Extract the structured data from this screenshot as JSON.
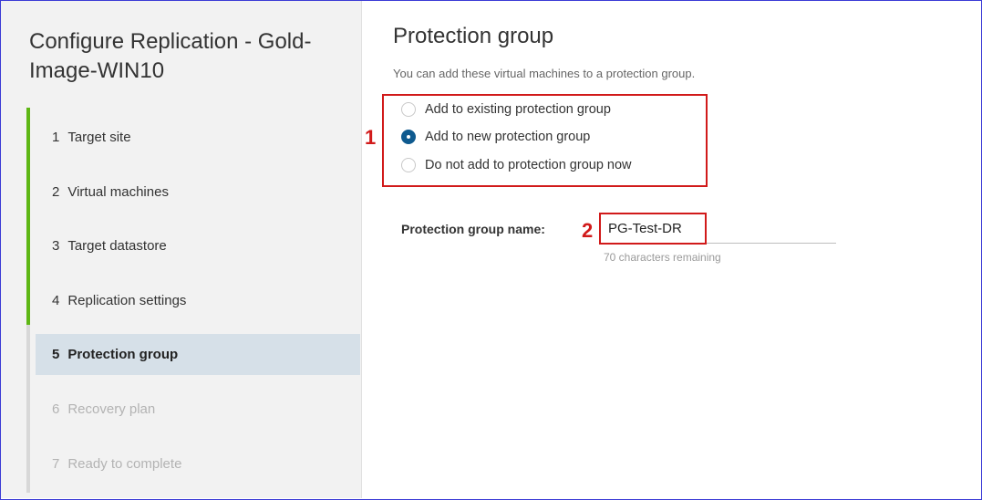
{
  "wizard": {
    "title": "Configure Replication - Gold-Image-WIN10",
    "steps": [
      {
        "num": "1",
        "label": "Target site"
      },
      {
        "num": "2",
        "label": "Virtual machines"
      },
      {
        "num": "3",
        "label": "Target datastore"
      },
      {
        "num": "4",
        "label": "Replication settings"
      },
      {
        "num": "5",
        "label": "Protection group"
      },
      {
        "num": "6",
        "label": "Recovery plan"
      },
      {
        "num": "7",
        "label": "Ready to complete"
      }
    ],
    "active_step": 5
  },
  "main": {
    "title": "Protection group",
    "subtitle": "You can add these virtual machines to a protection group.",
    "options": [
      {
        "label": "Add to existing protection group",
        "checked": false
      },
      {
        "label": "Add to new protection group",
        "checked": true
      },
      {
        "label": "Do not add to protection group now",
        "checked": false
      }
    ],
    "field_label": "Protection group name:",
    "field_value": "PG-Test-DR",
    "helper": "70 characters remaining"
  },
  "annotations": {
    "one": "1",
    "two": "2",
    "color": "#d11a1a"
  },
  "colors": {
    "progress": "#5eb715",
    "active_step_bg": "#d6e0e8",
    "radio_checked": "#0f5a8f"
  }
}
